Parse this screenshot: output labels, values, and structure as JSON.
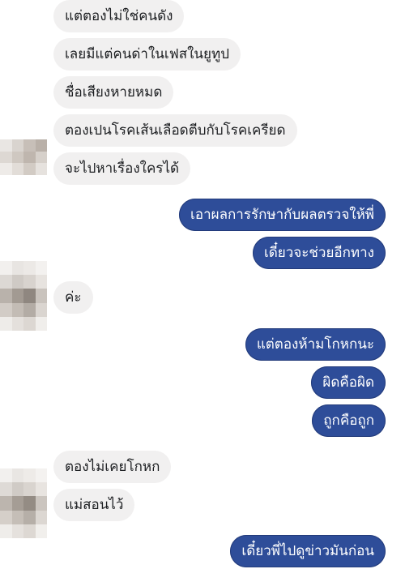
{
  "messages": [
    {
      "side": "in",
      "text": "แต่ตองไม่ใช่คนดัง"
    },
    {
      "side": "in",
      "text": "เลยมีแต่คนด่าในเฟสในยูทูป"
    },
    {
      "side": "in",
      "text": "ชื่อเสียงหายหมด"
    },
    {
      "side": "in",
      "text": "ตองเปนโรคเส้นเลือดตีบกับโรคเครียด"
    },
    {
      "side": "in",
      "text": "จะไปหาเรื่องใครได้"
    },
    {
      "side": "out",
      "text": "เอาผลการรักษากับผลตรวจให้พี่"
    },
    {
      "side": "out",
      "text": "เดี๋ยวจะช่วยอีกทาง"
    },
    {
      "side": "in",
      "text": "ค่ะ"
    },
    {
      "side": "out",
      "text": "แต่ตองห้ามโกหกนะ"
    },
    {
      "side": "out",
      "text": "ผิดคือผิด"
    },
    {
      "side": "out",
      "text": "ถูกคือถูก"
    },
    {
      "side": "in",
      "text": "ตองไม่เคยโกหก"
    },
    {
      "side": "in",
      "text": "แม่สอนไว้"
    },
    {
      "side": "out",
      "text": "เดี๋ยวพี่ไปดูข่าวมันก่อน"
    }
  ],
  "colors": {
    "incoming_bg": "#f1f0f0",
    "incoming_text": "#1c1e21",
    "outgoing_bg": "#2e4d99",
    "outgoing_text": "#ffffff"
  },
  "avatars": [
    {
      "label": "blurred-avatar-1"
    },
    {
      "label": "blurred-avatar-2"
    },
    {
      "label": "blurred-avatar-3"
    }
  ]
}
